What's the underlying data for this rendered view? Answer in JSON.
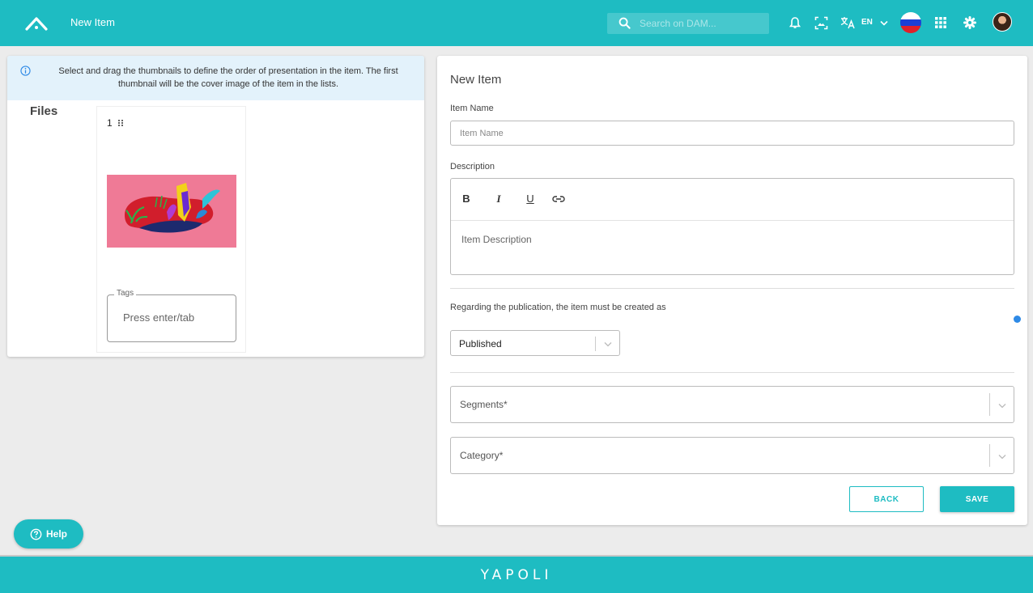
{
  "header": {
    "title": "New Item",
    "search_placeholder": "Search on DAM...",
    "language": "EN",
    "icons": [
      "logo-icon",
      "search-icon",
      "bell-icon",
      "image-search-icon",
      "translate-icon",
      "chevron-down-icon",
      "flag-icon",
      "apps-grid-icon",
      "gear-icon",
      "avatar"
    ]
  },
  "left": {
    "info_text": "Select and drag the thumbnails to define the order of presentation in the item. The first thumbnail will be the cover image of the item in the lists.",
    "files_label": "Files",
    "thumbnail": {
      "index": "1",
      "tags_legend": "Tags",
      "tags_placeholder": "Press enter/tab"
    }
  },
  "form": {
    "title": "New Item",
    "item_name_label": "Item Name",
    "item_name_placeholder": "Item Name",
    "description_label": "Description",
    "toolbar": [
      "B",
      "I",
      "U"
    ],
    "description_placeholder": "Item Description",
    "publication_question": "Regarding the publication, the item must be created as",
    "publication_value": "Published",
    "segments_placeholder": "Segments*",
    "category_placeholder": "Category*",
    "back_label": "BACK",
    "save_label": "SAVE"
  },
  "help_label": "Help",
  "footer_logo": "YAPOLI",
  "colors": {
    "brand": "#1ebcc2",
    "info_bg": "#e3f2fb",
    "dot": "#2e8ae6"
  }
}
